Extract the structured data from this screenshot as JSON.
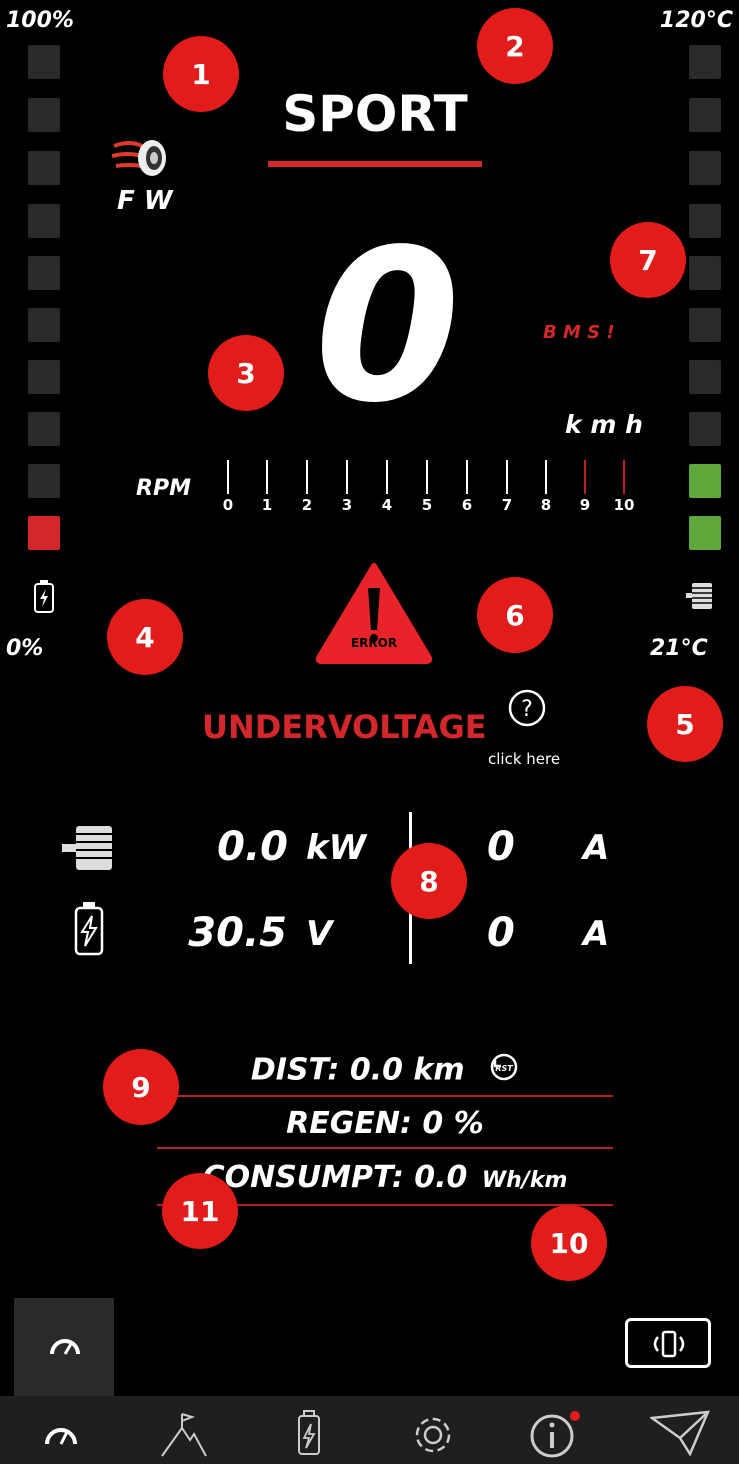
{
  "corners": {
    "battery_max": "100%",
    "battery_min": "0%",
    "temp_max": "120°C",
    "temp_current": "21°C"
  },
  "mode": {
    "label": "SPORT",
    "accent": "#d3272b"
  },
  "drive": {
    "label": "F W"
  },
  "speed": {
    "value": "0",
    "unit": "k m h"
  },
  "bms_warning": "B M S !",
  "rpm": {
    "label": "RPM",
    "ticks": [
      "0",
      "1",
      "2",
      "3",
      "4",
      "5",
      "6",
      "7",
      "8",
      "9",
      "10"
    ]
  },
  "battery_bar": {
    "lit_segments": 1,
    "total_segments": 10,
    "color": "#d3272b"
  },
  "temp_bar": {
    "lit_segments": 2,
    "total_segments": 10,
    "color": "#5fa83c"
  },
  "error": {
    "icon_label": "ERROR",
    "message": "UNDERVOLTAGE",
    "help_link": "click here"
  },
  "power": {
    "motor_value": "0.0",
    "motor_unit": "kW",
    "motor_current": "0",
    "motor_current_unit": "A",
    "battery_value": "30.5",
    "battery_unit": "V",
    "battery_current": "0",
    "battery_current_unit": "A"
  },
  "stats": {
    "dist": "DIST: 0.0 km",
    "regen": "REGEN: 0 %",
    "consumpt": "CONSUMPT: 0.0",
    "consumpt_unit": "Wh/km"
  },
  "badges": [
    "1",
    "2",
    "3",
    "4",
    "5",
    "6",
    "7",
    "8",
    "9",
    "10",
    "11"
  ],
  "nav": {
    "items": [
      "speedometer-icon",
      "mountain-flag-icon",
      "battery-icon",
      "gear-icon",
      "info-icon",
      "plane-icon"
    ]
  }
}
